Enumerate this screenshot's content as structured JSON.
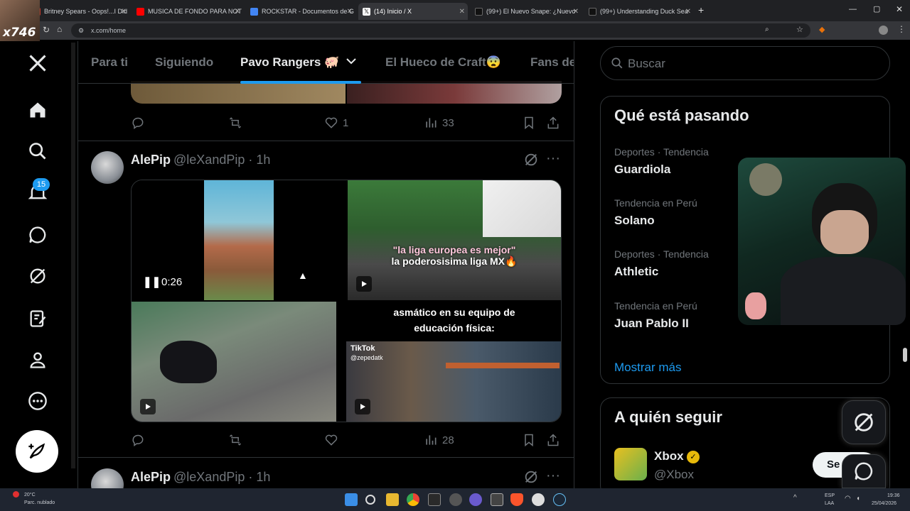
{
  "browser": {
    "tabs": [
      {
        "label": "Britney Spears - Oops!...I Did It",
        "color": "#c0392b"
      },
      {
        "label": "MUSICA DE FONDO PARA NOT",
        "color": "#ff0000"
      },
      {
        "label": "ROCKSTAR - Documentos de G",
        "color": "#4285f4"
      },
      {
        "label": "(14) Inicio / X",
        "color": "#000000"
      },
      {
        "label": "(99+) El Nuevo Snape: ¿Nuevo",
        "color": "#111111"
      },
      {
        "label": "(99+) Understanding Duck Sea",
        "color": "#111111"
      }
    ],
    "url": "x.com/home",
    "streamer_tag": "x746"
  },
  "leftnav": {
    "notif_count": "15",
    "items": [
      "x-logo-icon",
      "home-icon",
      "search-icon",
      "bell-icon",
      "messages-icon",
      "grok-icon",
      "notes-icon",
      "profile-icon",
      "more-icon"
    ]
  },
  "timeline": {
    "tabs": [
      {
        "label": "Para ti"
      },
      {
        "label": "Siguiendo"
      },
      {
        "label": "Pavo Rangers 🐖"
      },
      {
        "label": "El Hueco de Craft😨"
      },
      {
        "label": "Fans de"
      }
    ],
    "prev_post": {
      "likes": "1",
      "views": "33"
    },
    "post1": {
      "name": "AlePip",
      "handle": "@leXandPip · 1h",
      "video_time": "0:26",
      "caption1_line1": "\"la liga europea es mejor\"",
      "caption1_line2": "la poderosisima liga MX🔥",
      "caption2_line1": "asmático en su equipo de",
      "caption2_line2": "educación física:",
      "tiktok_label": "TikTok",
      "tiktok_user": "@zepedatk",
      "views": "28"
    },
    "post2": {
      "name": "AlePip",
      "handle": "@leXandPip · 1h"
    }
  },
  "sidebar": {
    "search_placeholder": "Buscar",
    "trends_title": "Qué está pasando",
    "trends": [
      {
        "meta": "Deportes · Tendencia",
        "name": "Guardiola"
      },
      {
        "meta": "Tendencia en Perú",
        "name": "Solano"
      },
      {
        "meta": "Deportes · Tendencia",
        "name": "Athletic"
      },
      {
        "meta": "Tendencia en Perú",
        "name": "Juan Pablo II"
      }
    ],
    "show_more": "Mostrar más",
    "follow_title": "A quién seguir",
    "follow": {
      "name": "Xbox",
      "handle": "@Xbox",
      "button": "Se"
    }
  },
  "taskbar": {
    "weather_temp": "20°C",
    "weather_desc": "Parc. nublado",
    "lang1": "ESP",
    "lang2": "LAA",
    "time": "19:36",
    "date": "25/04/2026"
  },
  "colors": {
    "accent": "#1d9bf0",
    "bg": "#000000",
    "border": "#2f3336",
    "muted": "#71767b"
  }
}
